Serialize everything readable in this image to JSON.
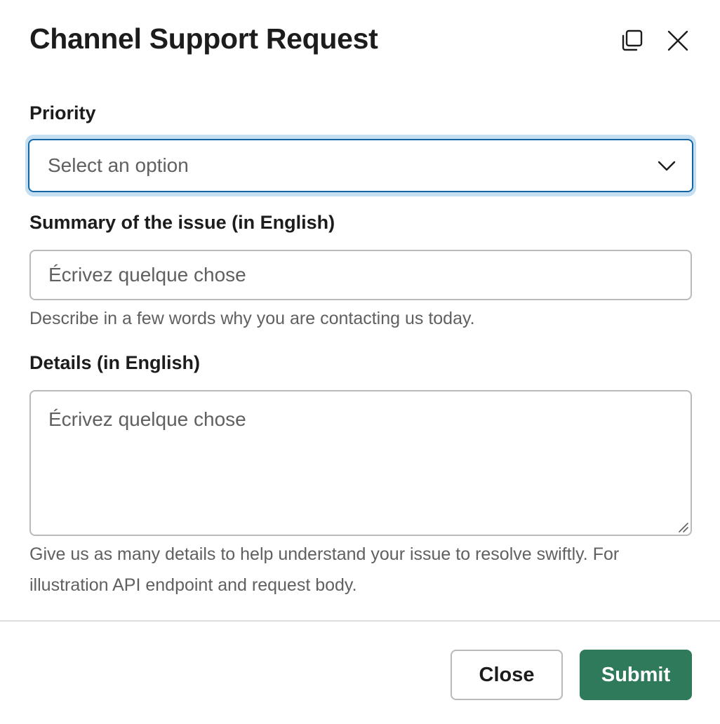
{
  "modal": {
    "title": "Channel Support Request"
  },
  "header_icons": {
    "popout": "popout-window-icon",
    "close": "close-icon"
  },
  "form": {
    "priority": {
      "label": "Priority",
      "placeholder": "Select an option",
      "value": ""
    },
    "summary": {
      "label": "Summary of the issue (in English)",
      "placeholder": "Écrivez quelque chose",
      "value": "",
      "hint": "Describe in a few words why you are contacting us today."
    },
    "details": {
      "label": "Details (in English)",
      "placeholder": "Écrivez quelque chose",
      "value": "",
      "hint": "Give us as many details to help understand your issue to resolve swiftly. For illustration API endpoint and request body."
    }
  },
  "footer": {
    "close_label": "Close",
    "submit_label": "Submit"
  },
  "colors": {
    "focus_border": "#1264a3",
    "focus_ring": "#c5dff2",
    "submit_bg": "#2e7a5a"
  }
}
